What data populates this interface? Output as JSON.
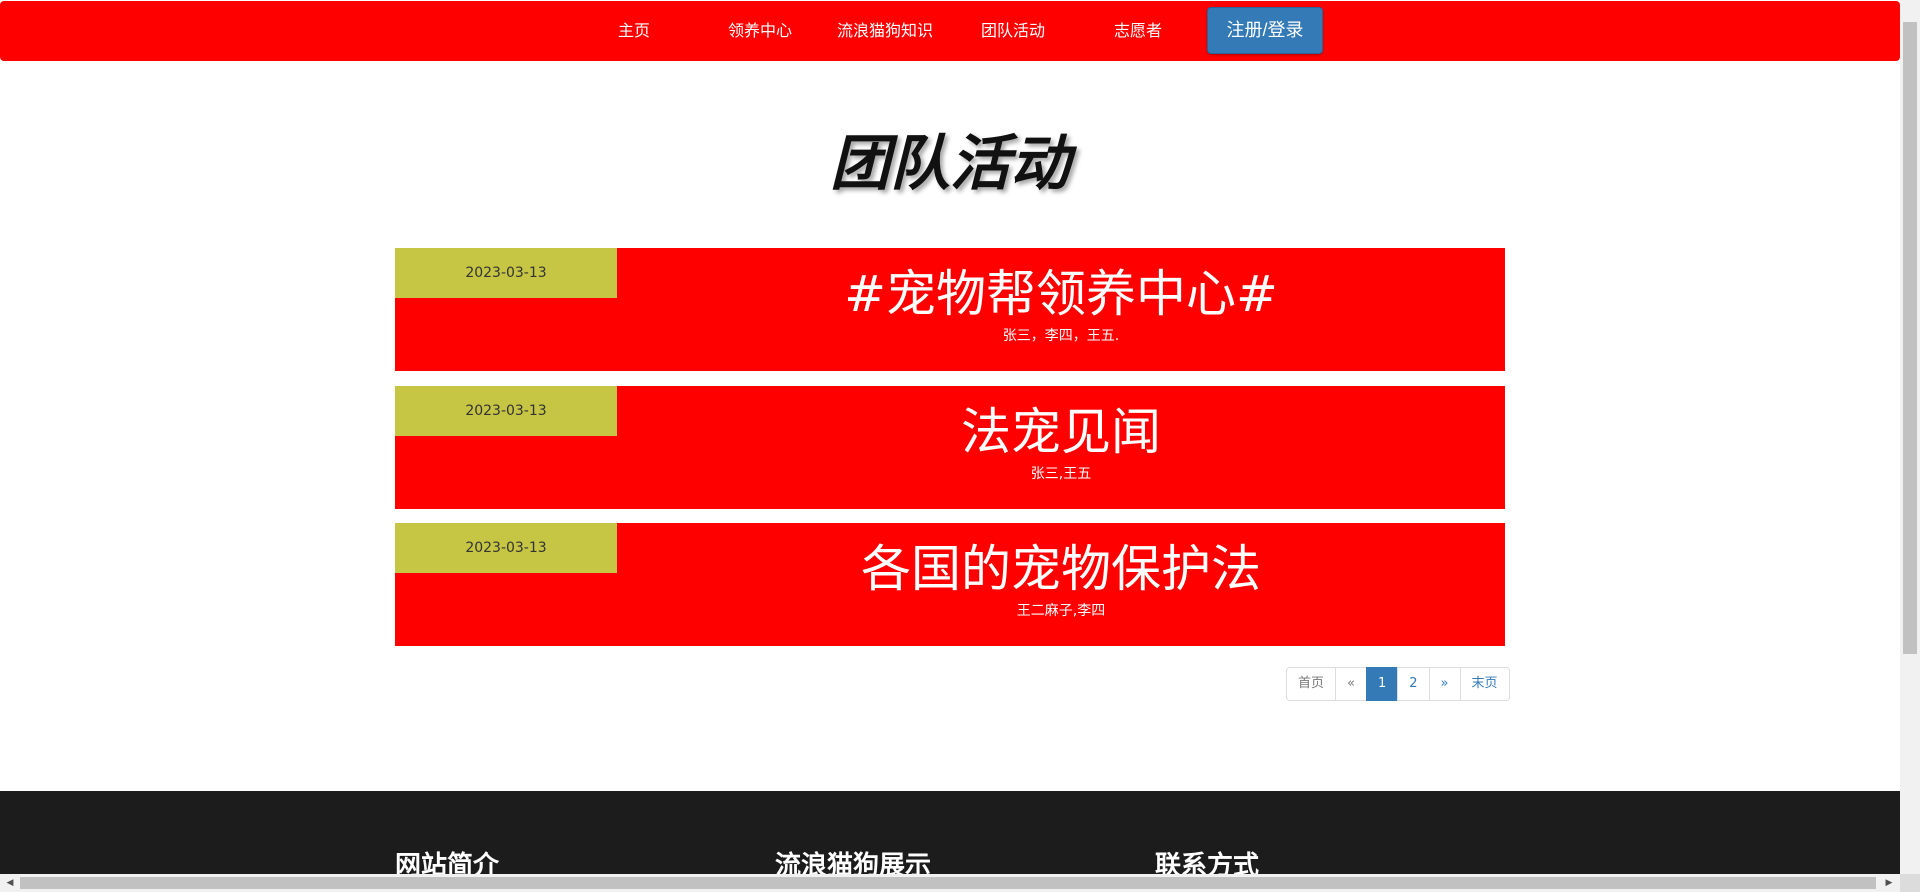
{
  "nav": {
    "items": [
      "主页",
      "领养中心",
      "流浪猫狗知识",
      "团队活动",
      "志愿者"
    ],
    "login_label": "注册/登录"
  },
  "page": {
    "title": "团队活动"
  },
  "activities": [
    {
      "date": "2023-03-13",
      "title": "#宠物帮领养中心#",
      "members": "张三，李四，王五."
    },
    {
      "date": "2023-03-13",
      "title": "法宠见闻",
      "members": "张三,王五"
    },
    {
      "date": "2023-03-13",
      "title": "各国的宠物保护法",
      "members": "王二麻子,李四"
    }
  ],
  "pagination": {
    "first": "首页",
    "prev": "«",
    "pages": [
      "1",
      "2"
    ],
    "active": "1",
    "next": "»",
    "last": "末页"
  },
  "footer": {
    "headings": [
      "网站简介",
      "流浪猫狗展示",
      "联系方式"
    ]
  },
  "colors": {
    "brand_red": "#ff0000",
    "date_olive": "#c7c544",
    "primary_blue": "#337ab7",
    "footer_dark": "#1d1c1d"
  },
  "icons": {
    "scroll_left": "scroll-left-arrow-icon",
    "scroll_right": "scroll-right-arrow-icon"
  }
}
